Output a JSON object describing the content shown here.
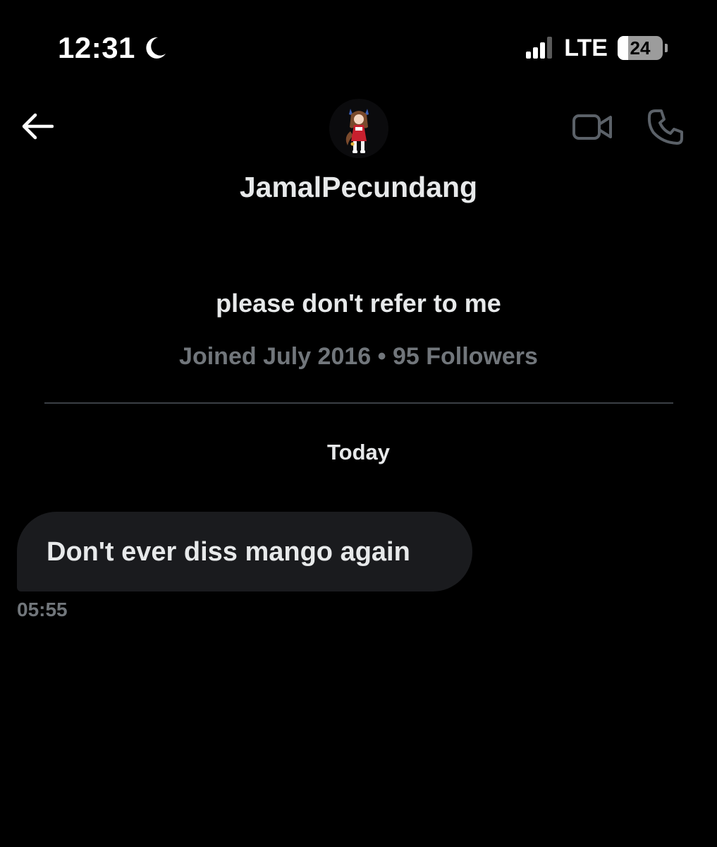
{
  "status_bar": {
    "time": "12:31",
    "network": "LTE",
    "battery_level": "24",
    "battery_fraction": 0.24,
    "moon_icon": "moon-icon",
    "signal_icon": "cellular-signal-icon"
  },
  "header": {
    "back_icon": "back-arrow-icon",
    "avatar_icon": "anime-avatar",
    "video_icon": "video-camera-icon",
    "call_icon": "phone-icon",
    "display_name": "JamalPecundang"
  },
  "profile": {
    "bio": "please don't refer to me",
    "meta": "Joined July 2016 • 95 Followers"
  },
  "conversation": {
    "day_label": "Today",
    "messages": [
      {
        "text": "Don't ever diss mango again",
        "time": "05:55"
      }
    ]
  },
  "colors": {
    "background": "#000000",
    "primary_text": "#e7e9ea",
    "secondary_text": "#71767b",
    "bubble": "#1a1b1e",
    "divider": "#3b3f45",
    "icon_muted": "#5b6168"
  }
}
